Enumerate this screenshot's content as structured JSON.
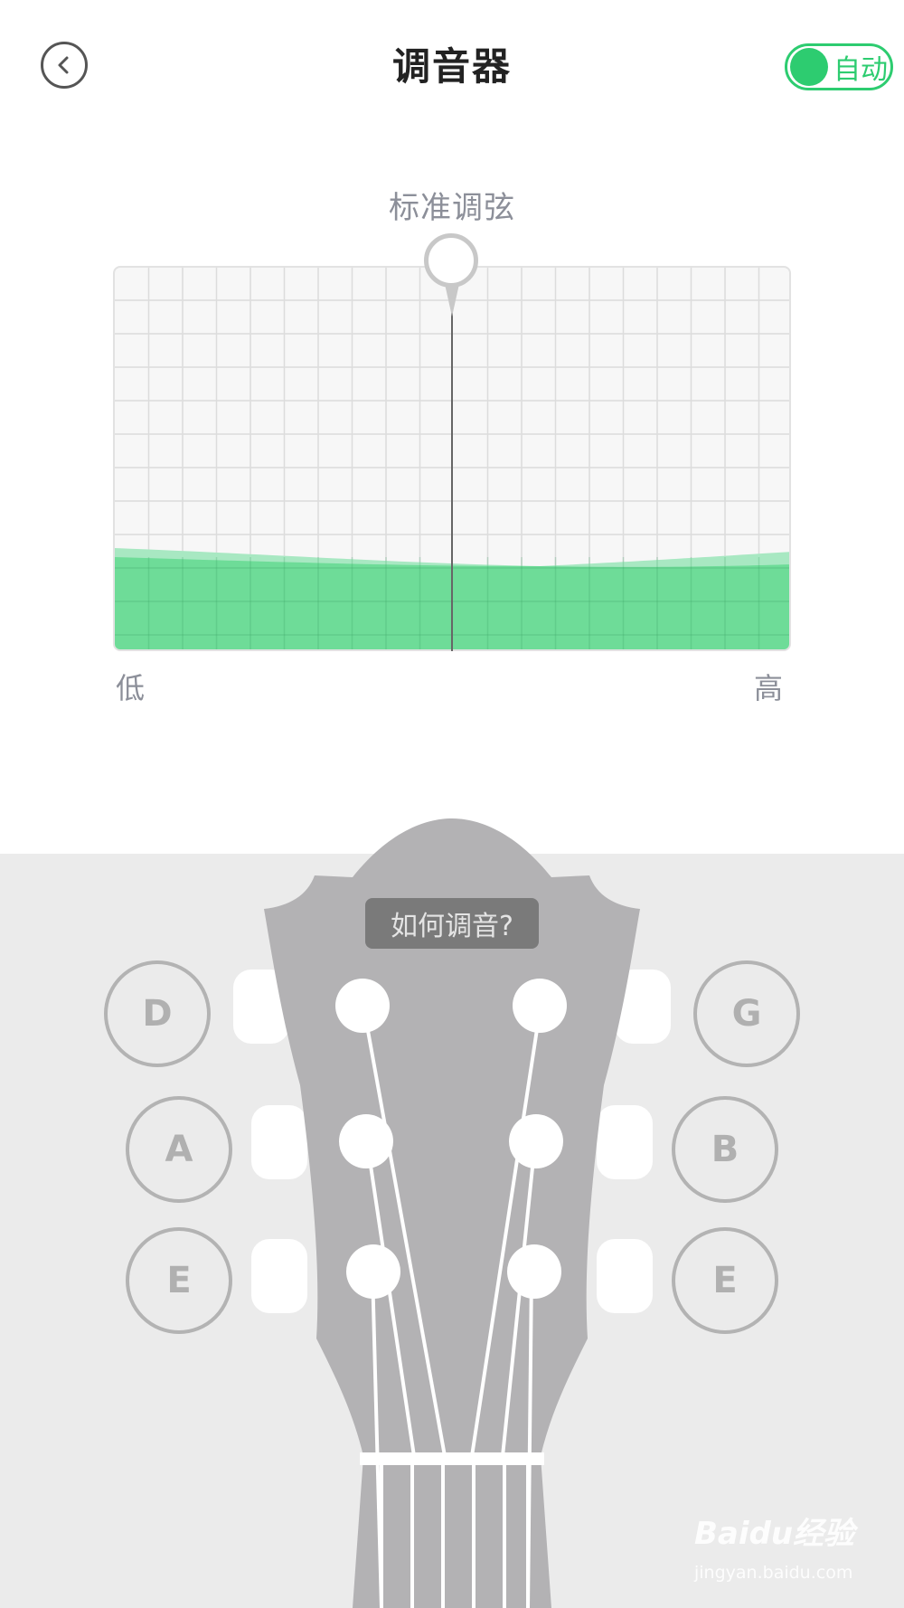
{
  "header": {
    "title": "调音器",
    "auto_toggle": {
      "label": "自动",
      "on": true,
      "color": "#2dcc70"
    }
  },
  "tuner": {
    "mode_label": "标准调弦",
    "low_label": "低",
    "high_label": "高",
    "fill_color": "#6edc98"
  },
  "headstock": {
    "how_to_tune": "如何调音?",
    "strings_left": [
      "D",
      "A",
      "E"
    ],
    "strings_right": [
      "G",
      "B",
      "E"
    ]
  },
  "watermark": {
    "logo_text": "Baidu经验",
    "url": "jingyan.baidu.com"
  }
}
